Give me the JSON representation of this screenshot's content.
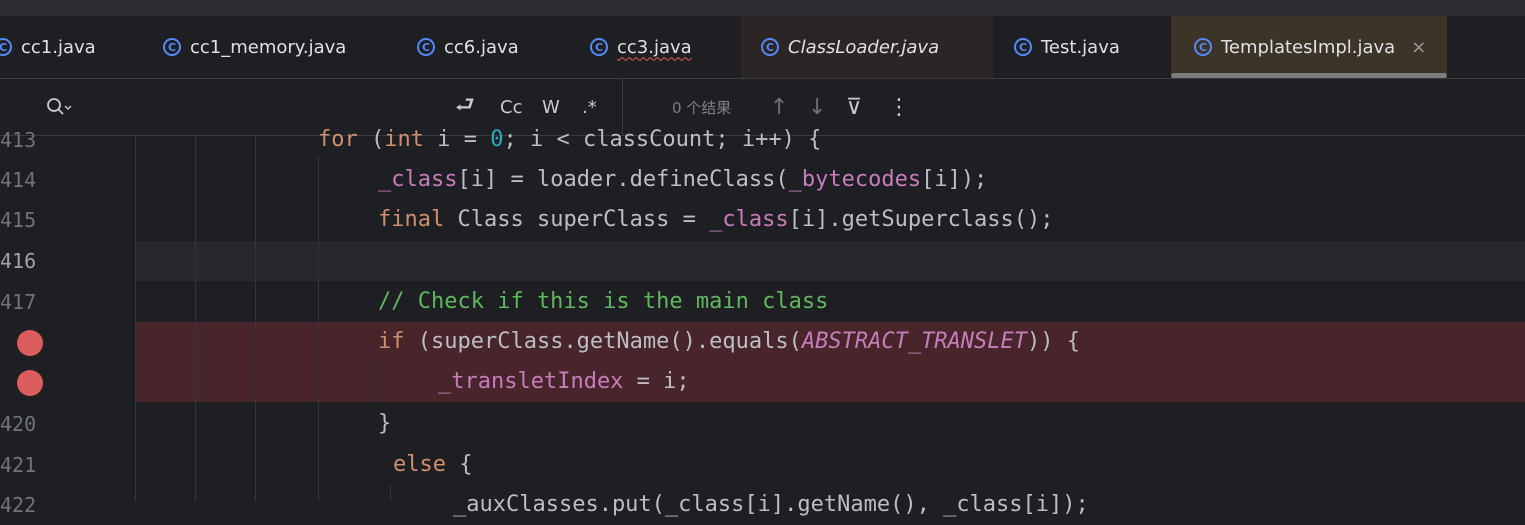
{
  "tabs": [
    {
      "label": "cc1.java",
      "style": "normal"
    },
    {
      "label": "cc1_memory.java",
      "style": "normal"
    },
    {
      "label": "cc6.java",
      "style": "normal"
    },
    {
      "label": "cc3.java",
      "style": "error-underline"
    },
    {
      "label": "ClassLoader.java",
      "style": "italic"
    },
    {
      "label": "Test.java",
      "style": "normal"
    },
    {
      "label": "TemplatesImpl.java",
      "style": "active",
      "close_glyph": "×"
    }
  ],
  "tab_icon_glyph": "C",
  "find": {
    "search_icon": "search-icon",
    "newline_glyph": "⮐",
    "match_case": "Cc",
    "words": "W",
    "regex": ".*",
    "results": "0 个结果",
    "up_glyph": "↑",
    "down_glyph": "↓",
    "filter_glyph": "⊽",
    "more_glyph": "⋮"
  },
  "editor": {
    "lines": [
      {
        "number": "413",
        "breakpoint": false,
        "current": false
      },
      {
        "number": "414",
        "breakpoint": false,
        "current": false
      },
      {
        "number": "415",
        "breakpoint": false,
        "current": false
      },
      {
        "number": "416",
        "breakpoint": false,
        "current": true
      },
      {
        "number": "417",
        "breakpoint": false,
        "current": false
      },
      {
        "number": "",
        "breakpoint": true,
        "current": false
      },
      {
        "number": "",
        "breakpoint": true,
        "current": false
      },
      {
        "number": "420",
        "breakpoint": false,
        "current": false
      },
      {
        "number": "421",
        "breakpoint": false,
        "current": false
      },
      {
        "number": "422",
        "breakpoint": false,
        "current": false
      }
    ],
    "code": {
      "l413": {
        "kw_for": "for",
        "p1": " (",
        "kw_int": "int",
        "p2": " i = ",
        "zero": "0",
        "p3": "; i < classCount; i++) {"
      },
      "l414": {
        "f1": "_class",
        "p1": "[i] = loader.defineClass(",
        "f2": "_bytecodes",
        "p2": "[i]);"
      },
      "l415": {
        "kw": "final",
        "p1": " Class superClass = ",
        "f1": "_class",
        "p2": "[i].getSuperclass();"
      },
      "l417": {
        "comment": "// Check if this is the main class"
      },
      "l418": {
        "kw": "if",
        "p1": " (superClass.getName().equals(",
        "const": "ABSTRACT_TRANSLET",
        "p2": ")) {"
      },
      "l419": {
        "f1": "_transletIndex",
        "p1": " = i;"
      },
      "l420": {
        "p1": "}"
      },
      "l421": {
        "kw": "else",
        "p1": " {"
      },
      "l422": {
        "p1": "_auxClasses.put(_class[i].getName(), _class[i]);"
      }
    }
  },
  "colors": {
    "background": "#1e1f22",
    "keyword": "#cf8e6d",
    "field": "#c77dbb",
    "comment": "#5fb85f",
    "number": "#2aacb8",
    "breakpoint": "#db5c5c",
    "breakpoint_line": "#47252a",
    "tab_icon": "#548af7"
  }
}
